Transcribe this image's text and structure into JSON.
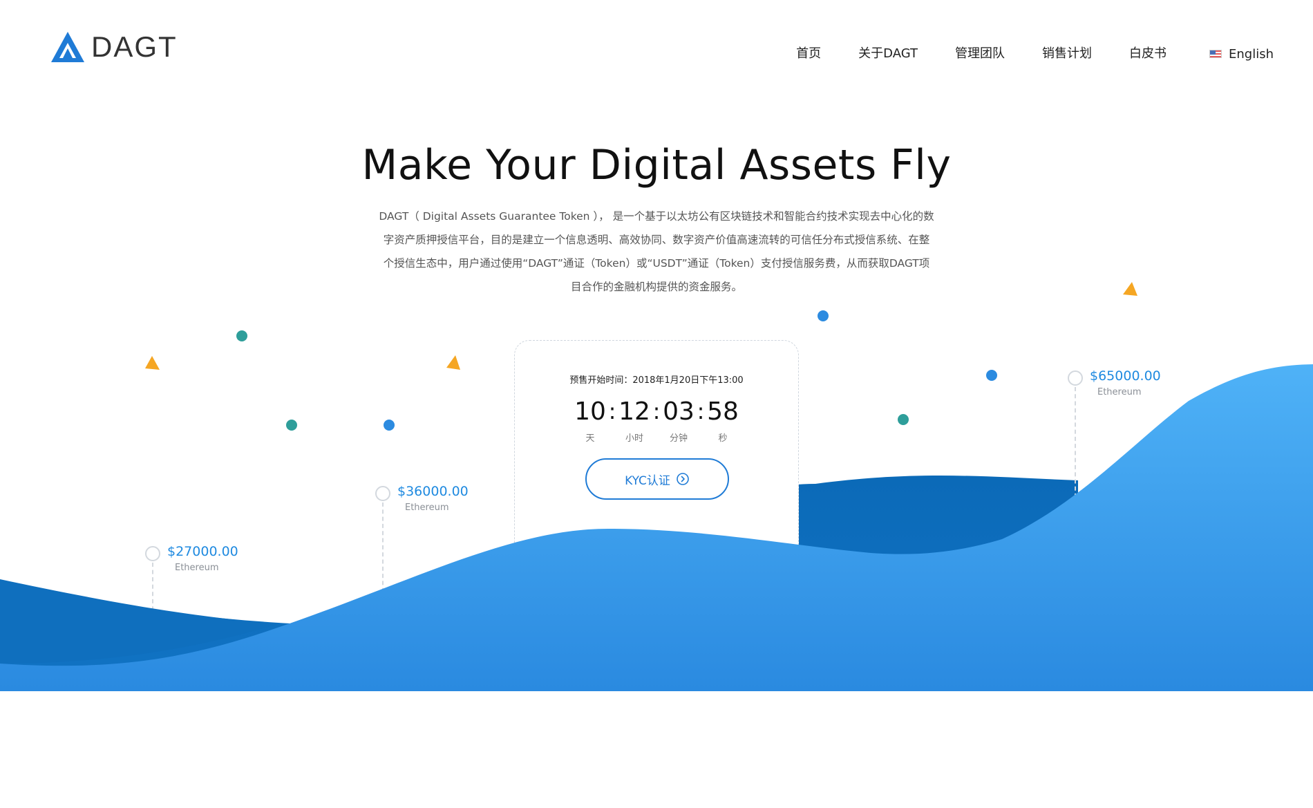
{
  "brand": {
    "name": "DAGT",
    "color": "#1f7bd6",
    "icon": "dagt-triangle-logo"
  },
  "nav": {
    "items": [
      {
        "label": "首页"
      },
      {
        "label": "关于DAGT"
      },
      {
        "label": "管理团队"
      },
      {
        "label": "销售计划"
      },
      {
        "label": "白皮书"
      }
    ],
    "language": {
      "label": "English",
      "icon": "us-flag-icon"
    }
  },
  "hero": {
    "title": "Make Your Digital Assets Fly",
    "description": "DAGT（ Digital Assets Guarantee Token ）， 是一个基于以太坊公有区块链技术和智能合约技术实现去中心化的数字资产质押授信平台，目的是建立一个信息透明、高效协同、数字资产价值高速流转的可信任分布式授信系统、在整个授信生态中，用户通过使用“DAGT”通证（Token）或“USDT”通证（Token）支付授信服务费，从而获取DAGT项目合作的金融机构提供的资金服务。"
  },
  "presale": {
    "start_label": "预售开始时间：2018年1月20日下午13:00",
    "countdown": [
      {
        "value": "10",
        "unit": "天"
      },
      {
        "value": "12",
        "unit": "小时"
      },
      {
        "value": "03",
        "unit": "分钟"
      },
      {
        "value": "58",
        "unit": "秒"
      }
    ],
    "separator": ":",
    "kyc_button": "KYC认证",
    "kyc_icon": "chevron-circle-right-icon"
  },
  "price_markers": [
    {
      "price": "$27000.00",
      "coin": "Ethereum"
    },
    {
      "price": "$36000.00",
      "coin": "Ethereum"
    },
    {
      "price": "$65000.00",
      "coin": "Ethereum"
    }
  ],
  "colors": {
    "wave_light": "#4aaef5",
    "wave_dark": "#0b6ab8",
    "dot_teal": "#2e9e9a",
    "dot_blue": "#2c8be0",
    "triangle_orange": "#f5a623"
  }
}
